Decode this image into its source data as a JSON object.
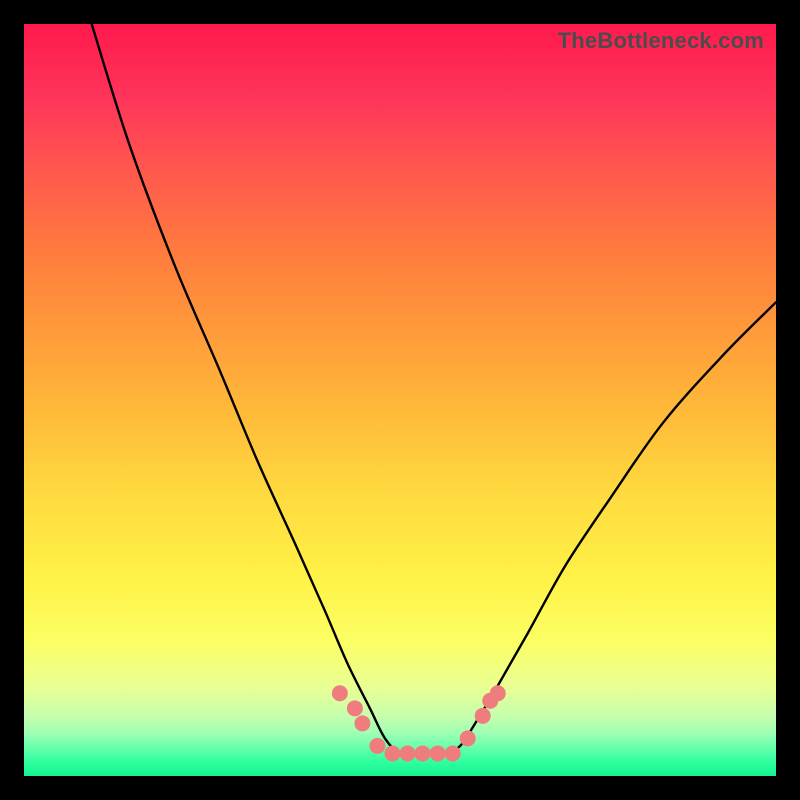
{
  "watermark": "TheBottleneck.com",
  "chart_data": {
    "type": "line",
    "title": "",
    "xlabel": "",
    "ylabel": "",
    "xlim": [
      0,
      100
    ],
    "ylim": [
      0,
      100
    ],
    "grid": false,
    "legend": false,
    "background_gradient": {
      "stops": [
        {
          "pos": 0,
          "color": "#ff1a4d"
        },
        {
          "pos": 0.4,
          "color": "#ff983a"
        },
        {
          "pos": 0.74,
          "color": "#fff247"
        },
        {
          "pos": 0.92,
          "color": "#c6ffad"
        },
        {
          "pos": 1.0,
          "color": "#14f58f"
        }
      ]
    },
    "series": [
      {
        "name": "bottleneck-curve",
        "color": "#000000",
        "x": [
          9,
          14,
          20,
          26,
          31,
          36,
          40,
          43,
          46,
          48,
          50,
          52,
          54,
          56,
          58,
          60,
          63,
          67,
          72,
          78,
          85,
          93,
          100
        ],
        "y": [
          100,
          84,
          68,
          54,
          42,
          31,
          22,
          15,
          9,
          5,
          3,
          3,
          3,
          3,
          4,
          7,
          12,
          19,
          28,
          37,
          47,
          56,
          63
        ]
      }
    ],
    "markers": {
      "name": "highlight-points",
      "color": "#f07d7d",
      "radius_px": 8,
      "points": [
        {
          "x": 42,
          "y": 11
        },
        {
          "x": 44,
          "y": 9
        },
        {
          "x": 45,
          "y": 7
        },
        {
          "x": 47,
          "y": 4
        },
        {
          "x": 49,
          "y": 3
        },
        {
          "x": 51,
          "y": 3
        },
        {
          "x": 53,
          "y": 3
        },
        {
          "x": 55,
          "y": 3
        },
        {
          "x": 57,
          "y": 3
        },
        {
          "x": 59,
          "y": 5
        },
        {
          "x": 61,
          "y": 8
        },
        {
          "x": 62,
          "y": 10
        },
        {
          "x": 63,
          "y": 11
        }
      ]
    }
  }
}
